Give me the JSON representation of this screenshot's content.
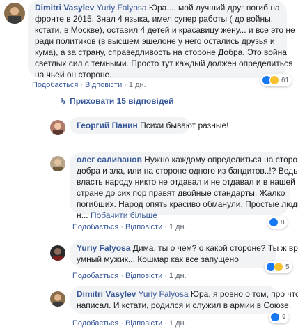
{
  "comments": [
    {
      "author": "Dimitri Vasylev",
      "tag": "Yuriy Falyosa",
      "lines": [
        " Юра.... мой лучший друг погиб на",
        "фронте в 2015. Знал 4 языка, имел супер работы ( до войны,",
        "кстати, в Москве), оставил 4 детей и красавицу жену... и все это не",
        "ради политиков (в высшем эшелоне у него остались друзья и",
        "кума), а за страну, справедливость на стороне Добра. Это война",
        "светлых сил с темными. Просто тут каждый должен определиться",
        "на чьей он стороне."
      ],
      "like": "Подобається",
      "reply": "Відповісти",
      "time": "1 дн.",
      "reactions": "61"
    },
    {
      "author": "Георгий Панин",
      "text": "Психи бывают разные!"
    },
    {
      "author": "олег саливанов",
      "lines": [
        " Нужно каждому определиться на стороне",
        "добра и зла, или на стороне одного из бандитов..!? Ведь",
        "власть народу никто не отдавал и не отдавал и в нашей",
        "стране до сих пор правят двойные стандарты. Жалко",
        "погибших. Народ опять красиво обманули. Простые люди"
      ],
      "ellipsis": "н...",
      "see_more": "Побачити більше",
      "like": "Подобається",
      "reply": "Відповісти",
      "time": "1 дн.",
      "reactions": "8"
    },
    {
      "author": "Yuriy Falyosa",
      "lines": [
        " Дима, ты о чем? о какой стороне? Ты ж вроде",
        "умный мужик... Кошмар как все запущено"
      ],
      "like": "Подобається",
      "reply": "Відповісти",
      "time": "1 дн.",
      "reactions": "5"
    },
    {
      "author": "Dimitri Vasylev",
      "tag": "Yuriy Falyosa",
      "lines": [
        " Юра, я ровно о том, про что",
        "написал. И кстати, родился и служил в армии в Союзе."
      ],
      "like": "Подобається",
      "reply": "Відповісти",
      "time": "1 дн.",
      "reactions": "9"
    }
  ],
  "hidden_replies": "Приховати 15 відповідей"
}
